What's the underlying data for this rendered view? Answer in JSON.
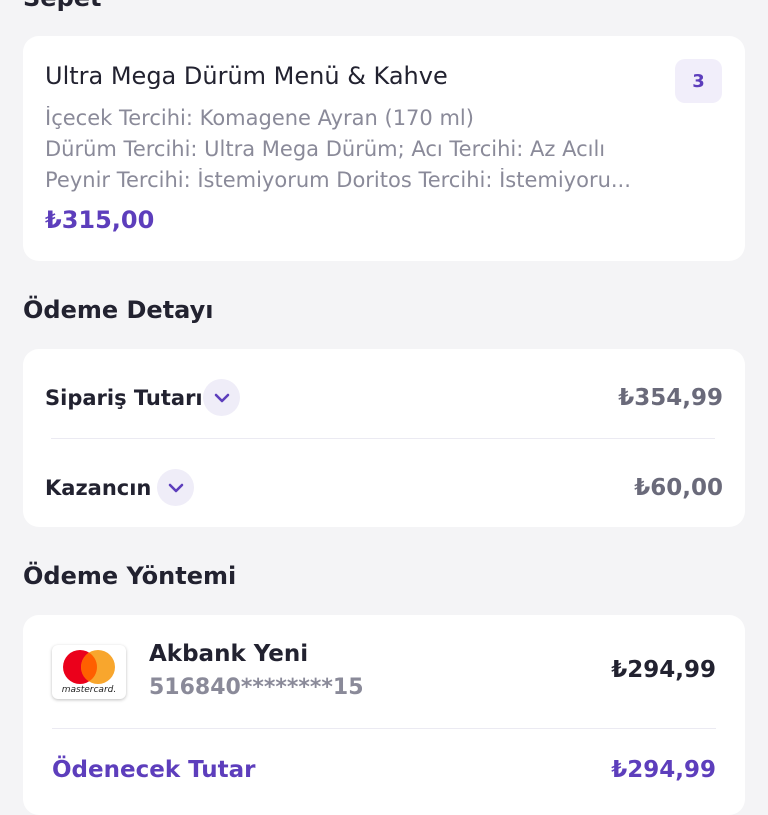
{
  "cart": {
    "title": "Sepet",
    "product": {
      "name": "Ultra Mega Dürüm Menü & Kahve",
      "options": [
        "İçecek Tercihi: Komagene Ayran (170 ml)",
        "Dürüm Tercihi: Ultra Mega Dürüm; Acı Tercihi: Az Acılı",
        "Peynir Tercihi: İstemiyorum Doritos Tercihi: İstemiyoru..."
      ],
      "price": "₺315,00",
      "quantity": "3"
    }
  },
  "payment_detail": {
    "title": "Ödeme Detayı",
    "rows": [
      {
        "label": "Sipariş Tutarı",
        "value": "₺354,99"
      },
      {
        "label": "Kazancın",
        "value": "₺60,00"
      }
    ]
  },
  "payment_method": {
    "title": "Ödeme Yöntemi",
    "card": {
      "brand_word": "mastercard.",
      "bank": "Akbank Yeni",
      "number": "516840********15",
      "amount": "₺294,99"
    },
    "total_label": "Ödenecek Tutar",
    "total_value": "₺294,99"
  },
  "colors": {
    "accent": "#5d3ebc",
    "background": "#f4f4f6",
    "mc_red": "#eb001b",
    "mc_orange": "#f79e1b"
  }
}
